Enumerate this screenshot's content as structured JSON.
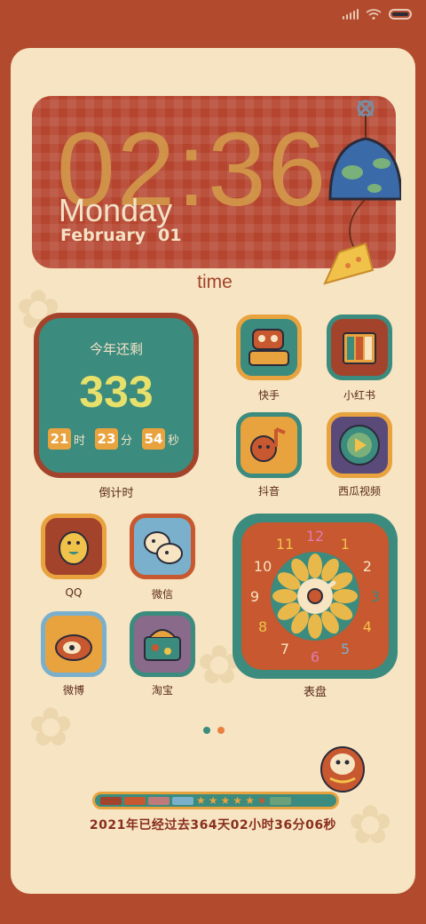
{
  "status": {
    "signal": "signal-icon",
    "wifi": "wifi-icon",
    "battery": "battery-icon"
  },
  "time_widget": {
    "time": "02:36",
    "weekday": "Monday",
    "month": "February",
    "day": "01",
    "label": "time"
  },
  "countdown": {
    "title": "今年还剩",
    "days": "333",
    "hours": "21",
    "hours_unit": "时",
    "minutes": "23",
    "minutes_unit": "分",
    "seconds": "54",
    "seconds_unit": "秒",
    "label": "倒计时"
  },
  "apps": [
    {
      "label": "快手"
    },
    {
      "label": "小红书"
    },
    {
      "label": "抖音"
    },
    {
      "label": "西瓜视频"
    },
    {
      "label": "QQ"
    },
    {
      "label": "微信"
    },
    {
      "label": "微博"
    },
    {
      "label": "淘宝"
    }
  ],
  "clock_widget": {
    "label": "表盘",
    "numbers": [
      "12",
      "1",
      "2",
      "3",
      "4",
      "5",
      "6",
      "7",
      "8",
      "9",
      "10",
      "11"
    ]
  },
  "progress": {
    "text": "2021年已经过去364天02小时36分06秒",
    "current_page": 2,
    "page_count": 2
  },
  "colors": {
    "brand_red": "#b24a2e",
    "teal": "#3b8b7e",
    "mustard": "#e9a33e",
    "cream": "#f6e4c2"
  }
}
